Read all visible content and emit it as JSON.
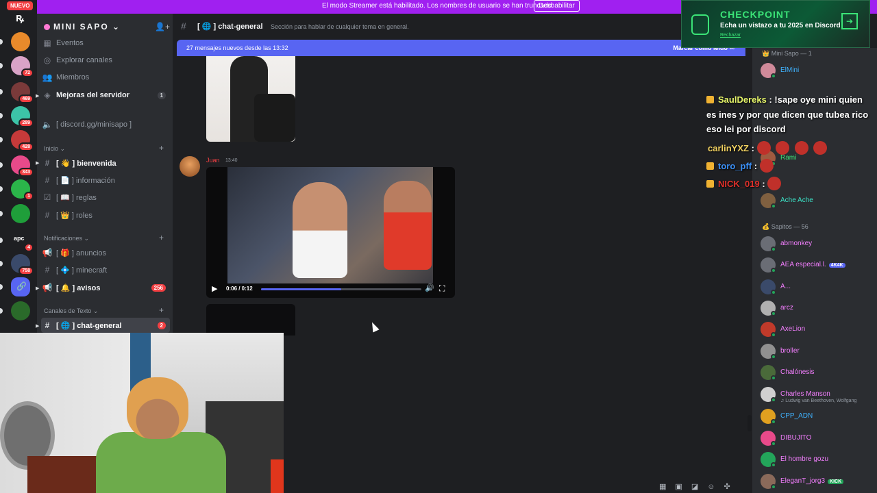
{
  "streamer_banner": {
    "text": "El modo Streamer está habilitado. Los nombres de usuario se han truncado.",
    "button": "Deshabilitar"
  },
  "rail": {
    "new_badge": "NUEVO",
    "servers": [
      {
        "badge": "",
        "color": "#e88a2b"
      },
      {
        "badge": "72",
        "color": "#d9a3c7"
      },
      {
        "badge": "469",
        "color": "#7a3a3a"
      },
      {
        "badge": "289",
        "color": "#3cc4a8"
      },
      {
        "badge": "428",
        "color": "#c63a3a"
      },
      {
        "badge": "343",
        "color": "#e84a8a"
      },
      {
        "badge": "1",
        "color": "#2bb54a"
      },
      {
        "badge": "",
        "color": "#1f9e3a"
      },
      {
        "badge": "4",
        "color": "#1e1f22"
      },
      {
        "badge": "758",
        "color": "#3a4a6a"
      },
      {
        "badge": "",
        "color": "#5865f2"
      },
      {
        "badge": "",
        "color": "#2a6a2a"
      }
    ],
    "apc_label": "apc"
  },
  "server": {
    "name": "MINI SAPO",
    "nav": [
      {
        "label": "Eventos",
        "icon": "calendar-icon"
      },
      {
        "label": "Explorar canales",
        "icon": "compass-icon"
      },
      {
        "label": "Miembros",
        "icon": "members-icon"
      },
      {
        "label": "Mejoras del servidor",
        "icon": "boost-icon",
        "count": "1"
      }
    ],
    "invite": "[ discord.gg/minisapo ]",
    "categories": [
      {
        "name": "Inicio",
        "channels": [
          {
            "label": "[ 👋 ] bienvenida",
            "bold": true
          },
          {
            "label": "[ 📄 ] información"
          },
          {
            "label": "[ 📖 ] reglas"
          },
          {
            "label": "[ 👑 ] roles"
          }
        ]
      },
      {
        "name": "Notificaciones",
        "channels": [
          {
            "label": "[ 🎁 ] anuncios"
          },
          {
            "label": "[ 💠 ] minecraft"
          },
          {
            "label": "[ 🔔 ] avisos",
            "bold": true,
            "count": "256"
          }
        ]
      },
      {
        "name": "Canales de Texto",
        "channels": [
          {
            "label": "[ 🌐 ] chat-general",
            "active": true,
            "count": "2"
          }
        ]
      }
    ]
  },
  "channel": {
    "name": "[ 🌐 ] chat-general",
    "topic": "Sección para hablar de cualquier tema en general."
  },
  "new_messages": {
    "text": "27 mensajes nuevos desde las 13:32",
    "mark_read": "Marcar como leído"
  },
  "message": {
    "author": "Juan",
    "time": "13:40",
    "video_time": "0:06 / 0:12",
    "progress": 0.5
  },
  "checkpoint": {
    "title": "CHECKPOINT",
    "subtitle": "Echa un vistazo a tu 2025 en Discord",
    "dismiss": "Rechazar"
  },
  "overlay": [
    {
      "user": "SaulDereks",
      "color": "#e6f56a",
      "text": ": !sape oye mini quien"
    },
    {
      "user": "",
      "color": "#fff",
      "text": "es ines y por que dicen que tubea rico"
    },
    {
      "user": "",
      "color": "#fff",
      "text": "eso lei por discord"
    },
    {
      "user": "carlinYXZ",
      "color": "#f0d060",
      "text": ":"
    },
    {
      "user": "toro_pff",
      "color": "#3b8ff5",
      "text": ":"
    },
    {
      "user": "NICK_019",
      "color": "#e0302a",
      "text": ":"
    }
  ],
  "members": {
    "groups": [
      {
        "title": "Mini Sapo — 1"
      },
      {
        "title": "Sapitos — 56"
      }
    ],
    "list": [
      {
        "name": "ElMini",
        "color": "#3fb3ff",
        "av": "#d08a9a"
      },
      {
        "name": "Rami",
        "color": "#3be477",
        "av": "#a05a40"
      },
      {
        "name": "Ache Ache",
        "color": "#3be4c8",
        "av": "#806040"
      },
      {
        "name": "abmonkey",
        "color": "#f47fff",
        "av": "#6a6d75"
      },
      {
        "name": "AEA especial.l.",
        "color": "#f47fff",
        "av": "#6a6d75",
        "tag": "4K4K",
        "tagcolor": "#5865f2"
      },
      {
        "name": "A...",
        "color": "#f47fff",
        "av": "#3a4a6a"
      },
      {
        "name": "arcz",
        "color": "#f47fff",
        "av": "#b0b0b0"
      },
      {
        "name": "AxeLion",
        "color": "#f47fff",
        "av": "#c03a2a"
      },
      {
        "name": "broller",
        "color": "#f47fff",
        "av": "#909090"
      },
      {
        "name": "Chalónesis",
        "color": "#f47fff",
        "av": "#4a6a3a"
      },
      {
        "name": "Charles Manson",
        "color": "#f47fff",
        "av": "#d0d0d0",
        "sub": "♫ Ludwig van Beethoven, Wolfgang"
      },
      {
        "name": "CPP_ADN",
        "color": "#3fb3ff",
        "av": "#e0a020"
      },
      {
        "name": "DIBUJITO",
        "color": "#f47fff",
        "av": "#e84a8a"
      },
      {
        "name": "El hombre gozu",
        "color": "#f47fff",
        "av": "#23a55a"
      },
      {
        "name": "EleganT_jorg3",
        "color": "#f47fff",
        "av": "#8a6a5a",
        "tag": "KICK",
        "tagcolor": "#23a55a"
      }
    ]
  },
  "input_icons": [
    "gift-icon",
    "gif-icon",
    "sticker-icon",
    "emoji-icon",
    "apps-icon"
  ]
}
